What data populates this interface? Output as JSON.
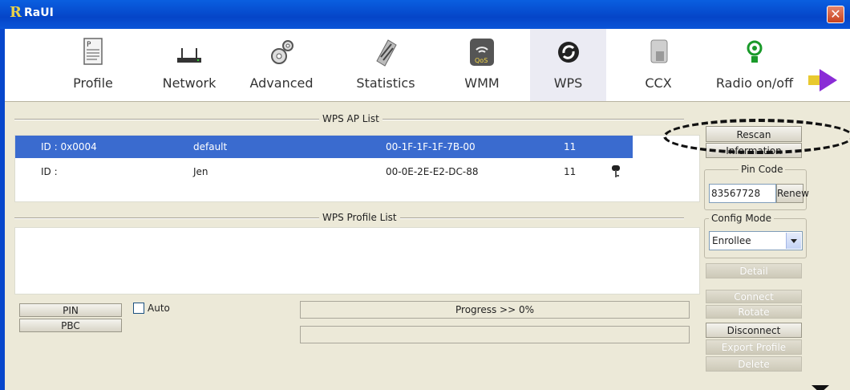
{
  "window": {
    "title": "RaUI",
    "logo": "R",
    "close_symbol": "✕"
  },
  "toolbar": {
    "items": [
      {
        "label": "Profile",
        "icon": "profile-icon"
      },
      {
        "label": "Network",
        "icon": "network-icon"
      },
      {
        "label": "Advanced",
        "icon": "advanced-icon"
      },
      {
        "label": "Statistics",
        "icon": "statistics-icon"
      },
      {
        "label": "WMM",
        "icon": "wmm-icon"
      },
      {
        "label": "WPS",
        "icon": "wps-icon"
      },
      {
        "label": "CCX",
        "icon": "ccx-icon"
      },
      {
        "label": "Radio on/off",
        "icon": "radio-icon"
      }
    ],
    "active": "WPS"
  },
  "wps_ap_list": {
    "title": "WPS AP List",
    "rows": [
      {
        "id": "ID : 0x0004",
        "ssid": "default",
        "bssid": "00-1F-1F-1F-7B-00",
        "channel": "11",
        "locked": false,
        "selected": true
      },
      {
        "id": "ID :",
        "ssid": "Jen",
        "bssid": "00-0E-2E-E2-DC-88",
        "channel": "11",
        "locked": true,
        "selected": false
      }
    ]
  },
  "wps_profile_list": {
    "title": "WPS Profile List"
  },
  "controls": {
    "pin_label": "PIN",
    "pbc_label": "PBC",
    "auto_label": "Auto",
    "auto_checked": false,
    "progress_text": "Progress >> 0%",
    "progress_value": 0
  },
  "side": {
    "rescan": "Rescan",
    "information": "Information",
    "pin_code_title": "Pin Code",
    "pin_code_value": "83567728",
    "renew": "Renew",
    "config_mode_title": "Config Mode",
    "config_mode_value": "Enrollee",
    "detail": "Detail",
    "connect": "Connect",
    "rotate": "Rotate",
    "disconnect": "Disconnect",
    "export_profile": "Export Profile",
    "delete": "Delete"
  },
  "colors": {
    "accent": "#3a6bcf",
    "titlebar": "#0545c8",
    "background": "#ece9d8"
  }
}
